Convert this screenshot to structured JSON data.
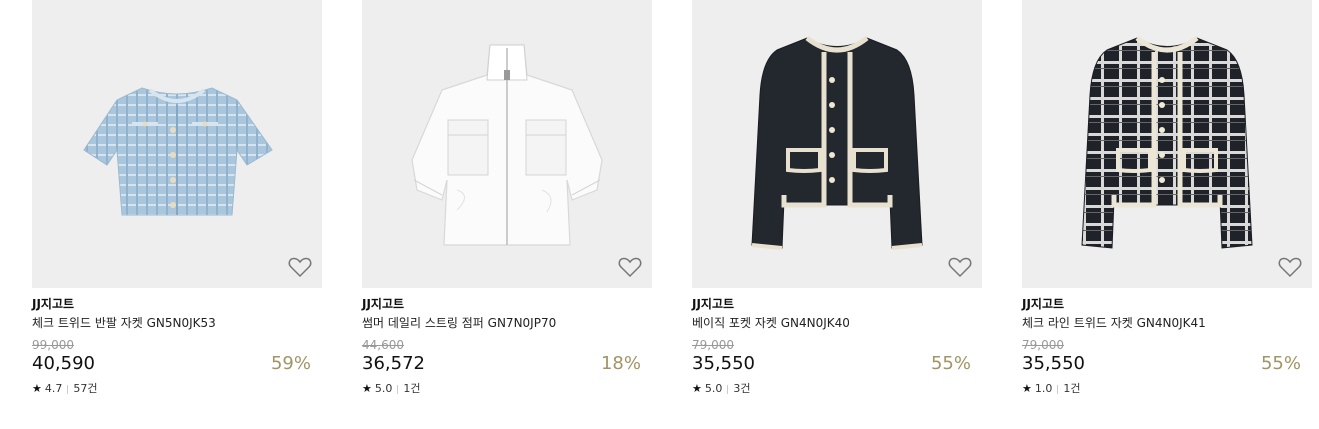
{
  "products": [
    {
      "brand": "JJ지고트",
      "name": "체크 트위드 반팔 자켓 GN5N0JK53",
      "original_price": "99,000",
      "price": "40,590",
      "discount": "59%",
      "rating": "4.7",
      "reviews": "57건",
      "wishlist_icon": "heart-outline-icon"
    },
    {
      "brand": "JJ지고트",
      "name": "썸머 데일리 스트링 점퍼 GN7N0JP70",
      "original_price": "44,600",
      "price": "36,572",
      "discount": "18%",
      "rating": "5.0",
      "reviews": "1건",
      "wishlist_icon": "heart-outline-icon"
    },
    {
      "brand": "JJ지고트",
      "name": "베이직 포켓 자켓 GN4N0JK40",
      "original_price": "79,000",
      "price": "35,550",
      "discount": "55%",
      "rating": "5.0",
      "reviews": "3건",
      "wishlist_icon": "heart-outline-icon"
    },
    {
      "brand": "JJ지고트",
      "name": "체크 라인 트위드 자켓 GN4N0JK41",
      "original_price": "79,000",
      "price": "35,550",
      "discount": "55%",
      "rating": "1.0",
      "reviews": "1건",
      "wishlist_icon": "heart-outline-icon"
    }
  ],
  "colors": {
    "discount": "#a39465",
    "image_background": "#eeeeee"
  },
  "star_glyph": "★"
}
